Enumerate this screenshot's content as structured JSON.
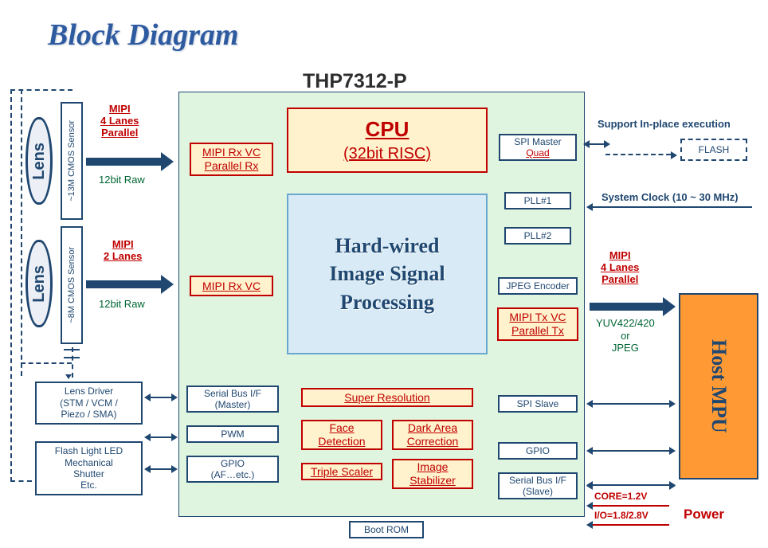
{
  "title": "Block Diagram",
  "chip_name": "THP7312-P",
  "lens": {
    "label": "Lens",
    "sensor1": "~13M CMOS Sensor",
    "sensor2": "~8M CMOS Sensor"
  },
  "left_labels": {
    "mipi1_a": "MIPI",
    "mipi1_b": "4 Lanes",
    "mipi1_c": "Parallel",
    "raw1": "12bit Raw",
    "mipi2_a": "MIPI",
    "mipi2_b": "2 Lanes",
    "raw2": "12bit Raw",
    "lens_driver_a": "Lens Driver",
    "lens_driver_b": "(STM / VCM /",
    "lens_driver_c": "Piezo / SMA)",
    "flash_a": "Flash Light LED",
    "flash_b": "Mechanical",
    "flash_c": "Shutter",
    "flash_d": "Etc."
  },
  "chip": {
    "mipi_rx_1_a": "MIPI Rx VC",
    "mipi_rx_1_b": "Parallel Rx",
    "mipi_rx_2": "MIPI Rx VC",
    "cpu": "CPU",
    "cpu_sub": "(32bit RISC)",
    "isp_a": "Hard-wired",
    "isp_b": "Image Signal",
    "isp_c": "Processing",
    "spi_master_a": "SPI Master",
    "spi_master_b": "Quad",
    "pll1": "PLL#1",
    "pll2": "PLL#2",
    "jpeg": "JPEG Encoder",
    "mipi_tx_a": "MIPI Tx VC",
    "mipi_tx_b": "Parallel Tx",
    "serial_m_a": "Serial Bus I/F",
    "serial_m_b": "(Master)",
    "pwm": "PWM",
    "gpio_l_a": "GPIO",
    "gpio_l_b": "(AF…etc.)",
    "super": "Super Resolution",
    "face_a": "Face",
    "face_b": "Detection",
    "dark_a": "Dark Area",
    "dark_b": "Correction",
    "triple": "Triple Scaler",
    "img_a": "Image",
    "img_b": "Stabilizer",
    "spi_slave": "SPI Slave",
    "gpio_r": "GPIO",
    "serial_s_a": "Serial Bus I/F",
    "serial_s_b": "(Slave)",
    "boot": "Boot ROM"
  },
  "right": {
    "support": "Support In-place execution",
    "flash": "FLASH",
    "sys_clock": "System Clock (10 ~ 30 MHz)",
    "mipi_a": "MIPI",
    "mipi_b": "4 Lanes",
    "mipi_c": "Parallel",
    "yuv_a": "YUV422/420",
    "yuv_b": "or",
    "yuv_c": "JPEG",
    "host": "Host MPU",
    "core": "CORE=1.2V",
    "io": "I/O=1.8/2.8V",
    "power": "Power"
  }
}
